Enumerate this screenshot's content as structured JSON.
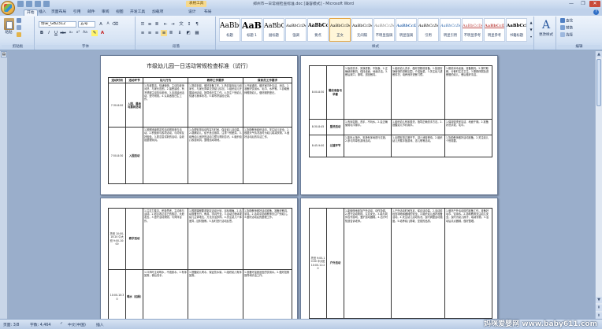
{
  "window": {
    "title": "郑州市一日常规检查标准.doc [兼容模式] - Microsoft Word",
    "context_tab": "表格工具",
    "controls": [
      "—",
      "❐",
      "✕"
    ]
  },
  "tabs": [
    {
      "label": "开始",
      "active": true
    },
    {
      "label": "插入"
    },
    {
      "label": "页面布局"
    },
    {
      "label": "引用"
    },
    {
      "label": "邮件"
    },
    {
      "label": "审阅"
    },
    {
      "label": "视图"
    },
    {
      "label": "开发工具"
    },
    {
      "label": "加载项"
    },
    {
      "label": "设计"
    },
    {
      "label": "布局"
    }
  ],
  "ribbon": {
    "clipboard": {
      "paste": "粘贴",
      "cut": "剪切",
      "copy": "复制",
      "format_painter": "格式刷",
      "label": "剪贴板"
    },
    "font": {
      "family": "仿宋_GB2312",
      "size": "五号",
      "label": "字体",
      "buttons": [
        "B",
        "I",
        "U",
        "abc",
        "x₂",
        "x²",
        "Aa",
        "A",
        "A"
      ]
    },
    "paragraph": {
      "label": "段落"
    },
    "styles": {
      "label": "样式",
      "items": [
        {
          "sample": "AaBbC",
          "name": "标题"
        },
        {
          "sample": "AaBl",
          "name": "标题 1"
        },
        {
          "sample": "AaBbC",
          "name": "副标题"
        },
        {
          "sample": "AaBbCcDc",
          "name": "强调"
        },
        {
          "sample": "AaBbCcD",
          "name": "要点"
        },
        {
          "sample": "AaBbCcDc",
          "name": "正文",
          "selected": true
        },
        {
          "sample": "AaBbCcDc",
          "name": "无间隔"
        },
        {
          "sample": "AaBbCcDc",
          "name": "不明显强调"
        },
        {
          "sample": "AaBbCcDc",
          "name": "明显强调"
        },
        {
          "sample": "AaBbCcDc",
          "name": "引用"
        },
        {
          "sample": "AaBbCcDc",
          "name": "明显引用"
        },
        {
          "sample": "AaBbCcDc",
          "name": "不明显参考"
        },
        {
          "sample": "AaBbCcDc",
          "name": "明显参考"
        },
        {
          "sample": "AaBbCcL",
          "name": "书籍标题"
        }
      ],
      "change_styles": "更改样式"
    },
    "editing": {
      "find": "查找",
      "replace": "替换",
      "select": "选择",
      "label": "编辑"
    }
  },
  "doc": {
    "title": "市级幼儿园一日活动常规检查标准（试行）",
    "headers": [
      "活动时间",
      "活动环节",
      "幼儿行为",
      "教师工作要求",
      "保育员工作要求"
    ],
    "page1_rows": [
      {
        "time": "7:30-8:00",
        "phase": "入园、晨检与晨间活动",
        "child": "1.衣着整洁，情绪愉快，主动向老师问好、与家长告别。2.接受晨检，有不舒服主动告诉老师。3.自选晨间活动，遵守规则。4.认真做值日生工作。",
        "teacher": "1.提前到岗，做好准备工作。2.热情接待幼儿和家长，与家长简单交流幼儿情况。3.组织幼儿开展晨间活动，指导值日生工作。4.关注个别幼儿情绪与身体状况。5.填写好晨检记录。",
        "care": "1.开窗通风，做好室内外清洁、消毒。2.准备好饮用水、毛巾、水杯等。3.协助教师照顾幼儿，做好服药登记。"
      },
      {
        "time": "7:50-8:30",
        "phase": "入园活动",
        "child": "1.按照班级规定的活动规则参与活动。2.积极参与各项活动，与同伴友好相处。3.愿意尝试新的活动，会收拾整理玩具。",
        "teacher": "1.合理安排活动内容与时间，保证幼儿活动量。2.观察幼儿，给予适当指导，注重个别差异。3.培养幼儿良好的活动习惯与规则意识。4.组织幼儿收拾玩具，整理活动场地。",
        "care": "1.协助教师组织活动，关注幼儿安全。2.根据天气情况及时为幼儿增减衣物。3.做好活动后的清洁工作。"
      }
    ],
    "page2_rows": [
      {
        "time": "8:00-8:30",
        "phase": "餐前准备与早餐",
        "child": "1.饭前洗手，安静进餐，不挑食。2.正确使用餐具，保持桌面、地面清洁。3.餐后漱口、擦嘴，送回餐具。",
        "teacher": "1.组织幼儿洗手，做好进餐前准备。2.营造安静愉快的进餐氛围，介绍饭菜。3.关注幼儿进餐情况，培养良好进餐习惯。",
        "care": "1.餐前消毒桌面，准备餐具。2.按时取餐，分餐时注意卫生。3.照顾体弱及进餐慢的幼儿，餐后做好清洁。"
      },
      {
        "time": "8:30-8:45",
        "phase": "盥洗活动",
        "child": "1.有序如厕、洗手，不玩水。2.会正确使用毛巾擦手。",
        "teacher": "1.组织幼儿有序盥洗，指导正确洗手方法。2.提醒幼儿节约用水。",
        "care": "1.保持盥洗室清洁、地面干燥。2.准备好洗手液、毛巾。"
      },
      {
        "time": "8:45-9:00",
        "phase": "过渡环节",
        "child": "1.能听从指令，安静有序地进行过渡。2.参与简单的游戏活动。",
        "teacher": "1.合理安排过渡环节，减少消极等待。2.组织幼儿开展手指游戏、念儿歌等活动。",
        "care": "1.协助教师做好活动准备。2.关注幼儿个别需要。"
      }
    ],
    "page3_rows": [
      {
        "time": "托班 10:00-10:20 中大班 9:00-10:00",
        "phase": "教学活动",
        "child": "1.注意力集中，积极思考，主动参与活动。2.愿意表达自己的想法，大胆发言。3.遵守活动规则，与同伴合作。",
        "teacher": "1.根据课程要求制定活动计划，目标明确。2.活动准备充分，教具、学具齐全。3.活动过程体现幼儿主体地位，方法灵活多样。4.关注幼儿个体差异，因材施教。5.及时进行活动反思。",
        "care": "1.协助教师做好活动准备，准备好教具、学具。2.活动中协助教师关注个别幼儿。3.做好活动后的整理工作。"
      },
      {
        "time": "10:00-10:30",
        "phase": "喝水（如厕）",
        "child": "1.口渴时主动喝水，不浪费水。2.有序如厕，便后洗手。",
        "teacher": "1.提醒幼儿喝水，保证饮水量。2.组织幼儿有序如厕。",
        "care": "1.准备好温度适宜的饮用水。2.做好如厕指导和清洁工作。"
      }
    ],
    "page4_rows": [
      {
        "time": "托班 9:00-10:00 中大班 10:00-11:20",
        "phase": "户外活动",
        "child": "1.能愉快地参加户外活动，动作协调。2.遵守活动规则，注意安全。3.能与同伴合作游戏，爱护运动器械。4.出汗时知道告诉老师。",
        "teacher": "1.户外活动时间充足，保证活动量。2.活动前检查场地和器械的安全。3.组织幼儿做好准备活动。4.关注幼儿活动情况，及时调整运动强度。5.培养幼儿勇敢、坚强的品质。",
        "care": "1.做好户外活动前的准备工作，准备好毛巾、饮用水。2.协助教师关注幼儿安全，及时为幼儿擦汗、增减衣物。3.活动后清点器械，做好整理。"
      }
    ]
  },
  "status": {
    "page": "页面: 3/8",
    "words": "字数: 4,464",
    "lang": "中文(中国)",
    "mode": "插入",
    "zoom": "40%"
  },
  "watermark": "妈咪爱婴网 www.baby611.com"
}
